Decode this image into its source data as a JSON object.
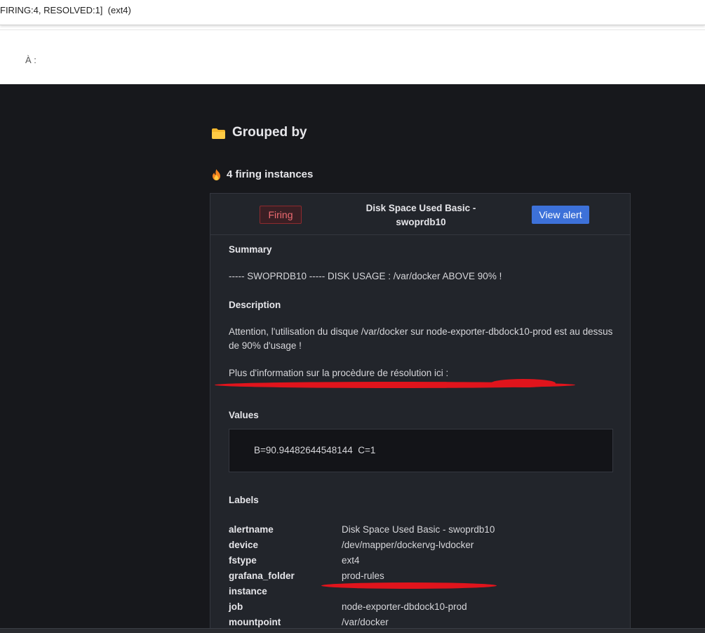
{
  "email": {
    "subject_fragment": "FIRING:4, RESOLVED:1]  (ext4)",
    "to_label": "À :"
  },
  "body": {
    "group_title": "Grouped by",
    "firing_count_title": "4 firing instances"
  },
  "alert": {
    "status_badge": "Firing",
    "name": "Disk Space Used Basic - swoprdb10",
    "view_button": "View alert",
    "summary_label": "Summary",
    "summary_text": "----- SWOPRDB10 ----- DISK USAGE : /var/docker ABOVE 90% !",
    "description_label": "Description",
    "description_text": "Attention, l'utilisation du disque /var/docker sur node-exporter-dbdock10-prod est au dessus de 90% d'usage !",
    "more_info_text": "Plus d'information sur la procèdure de résolution ici :",
    "values_label": "Values",
    "values_text": "B=90.94482644548144  C=1",
    "labels_label": "Labels",
    "labels": [
      {
        "key": "alertname",
        "value": "Disk Space Used Basic - swoprdb10"
      },
      {
        "key": "device",
        "value": "/dev/mapper/dockervg-lvdocker"
      },
      {
        "key": "fstype",
        "value": "ext4"
      },
      {
        "key": "grafana_folder",
        "value": "prod-rules"
      },
      {
        "key": "instance",
        "value": ""
      },
      {
        "key": "job",
        "value": "node-exporter-dbdock10-prod"
      },
      {
        "key": "mountpoint",
        "value": "/var/docker"
      }
    ]
  },
  "icons": {
    "group_icon": "folder-icon",
    "firing_icon": "fire-icon"
  },
  "colors": {
    "background": "#17181c",
    "card": "#22252b",
    "firing_text": "#ee6b71",
    "button": "#3d71d9",
    "redaction": "#e0141c"
  }
}
